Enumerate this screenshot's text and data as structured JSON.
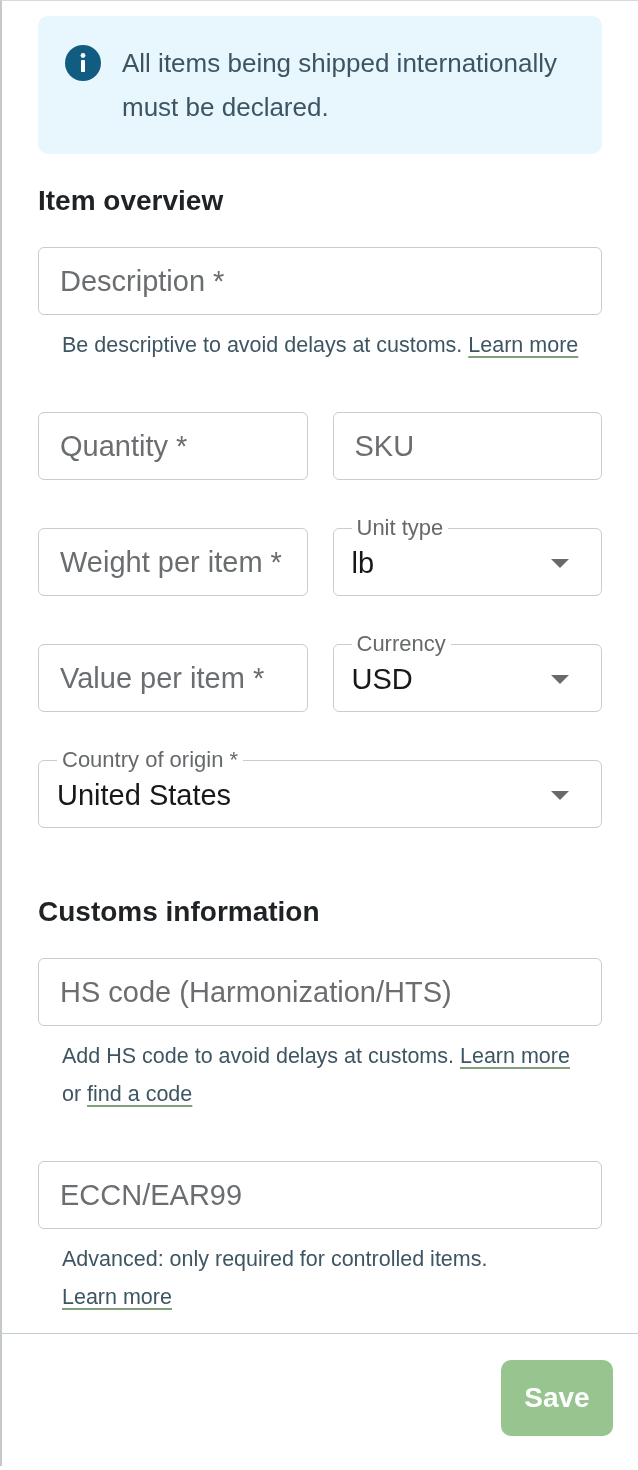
{
  "alert": {
    "text": "All items being shipped internationally must be declared."
  },
  "sections": [
    {
      "title": "Item overview",
      "rows": [
        {
          "fields": [
            {
              "kind": "text",
              "placeholder": "Description *"
            }
          ],
          "help": [
            {
              "kind": "text",
              "text": "Be descriptive to avoid delays at customs. "
            },
            {
              "kind": "link",
              "text": "Learn more"
            }
          ]
        },
        {
          "fields": [
            {
              "kind": "text",
              "placeholder": "Quantity *"
            },
            {
              "kind": "text",
              "placeholder": "SKU"
            }
          ]
        },
        {
          "fields": [
            {
              "kind": "text",
              "placeholder": "Weight per item *"
            },
            {
              "kind": "select",
              "label": "Unit type",
              "value": "lb"
            }
          ]
        },
        {
          "fields": [
            {
              "kind": "text",
              "placeholder": "Value per item *"
            },
            {
              "kind": "select",
              "label": "Currency",
              "value": "USD"
            }
          ]
        },
        {
          "fields": [
            {
              "kind": "select",
              "label": "Country of origin *",
              "value": "United States"
            }
          ]
        }
      ]
    },
    {
      "title": "Customs information",
      "rows": [
        {
          "fields": [
            {
              "kind": "text",
              "placeholder": "HS code (Harmonization/HTS)"
            }
          ],
          "help": [
            {
              "kind": "text",
              "text": "Add HS code to avoid delays at customs. "
            },
            {
              "kind": "link",
              "text": "Learn more"
            },
            {
              "kind": "text",
              "text": " or "
            },
            {
              "kind": "link",
              "text": "find a code"
            }
          ]
        },
        {
          "fields": [
            {
              "kind": "text",
              "placeholder": "ECCN/EAR99"
            }
          ],
          "help": [
            {
              "kind": "text",
              "text": "Advanced: only required for controlled items. "
            },
            {
              "kind": "link",
              "text": "Learn more"
            }
          ]
        }
      ]
    }
  ],
  "save_button": {
    "label": "Save",
    "disabled": true
  }
}
